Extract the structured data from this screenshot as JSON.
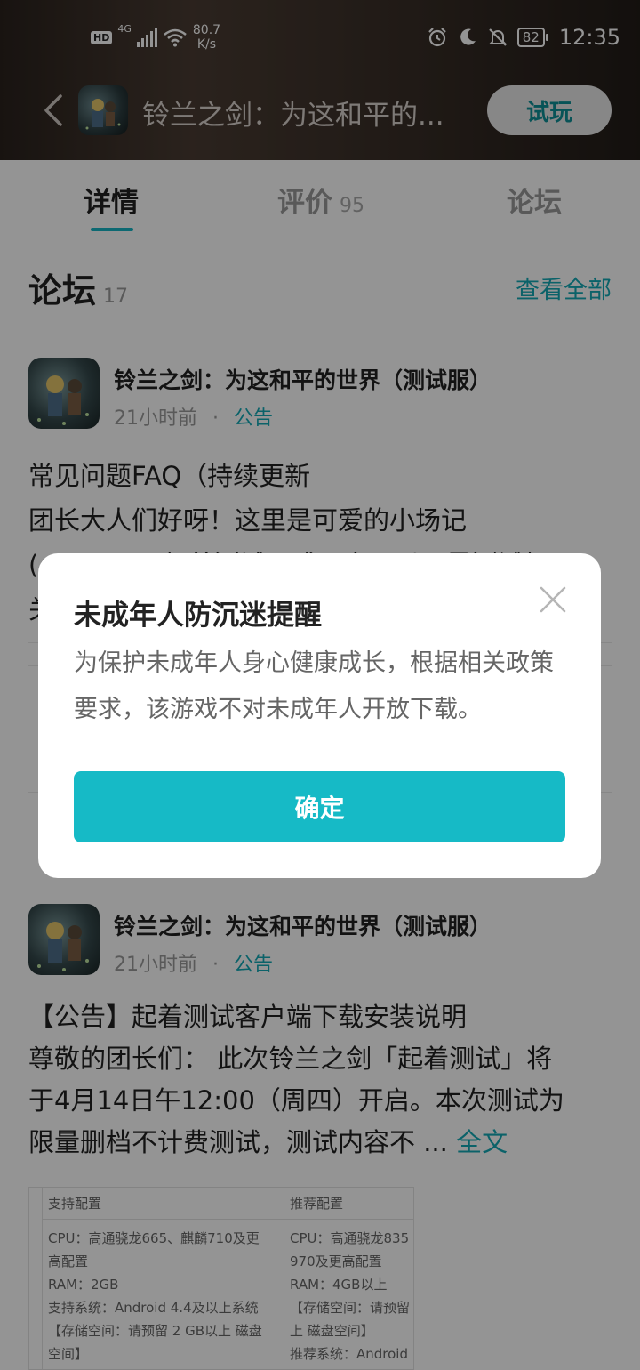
{
  "status_bar": {
    "hd_label": "HD",
    "network_type": "4G",
    "speed_value": "80.7",
    "speed_unit": "K/s",
    "battery": "82",
    "time": "12:35"
  },
  "header": {
    "title": "铃兰之剑：为这和平的...",
    "try_button": "试玩"
  },
  "tabs": [
    {
      "label": "详情",
      "count": ""
    },
    {
      "label": "评价",
      "count": "95"
    },
    {
      "label": "论坛",
      "count": ""
    }
  ],
  "forum": {
    "title": "论坛",
    "count": "17",
    "view_all": "查看全部"
  },
  "posts": [
    {
      "game": "铃兰之剑：为这和平的世界（测试服）",
      "time": "21小时前",
      "separator": "·",
      "tag": "公告",
      "lines": [
        "常见问题FAQ（持续更新",
        "团长大人们好呀！这里是可爱的小场记",
        "(●|ー|●)，起着测试正式开启，以下是测试相",
        "关"
      ]
    },
    {
      "game": "铃兰之剑：为这和平的世界（测试服）",
      "time": "21小时前",
      "separator": "·",
      "tag": "公告",
      "lines": [
        "【公告】起着测试客户端下载安装说明",
        "尊敬的团长们：  此次铃兰之剑「起着测试」将",
        "于4月14日午12:00（周四）开启。本次测试为",
        "限量删档不计费测试，测试内容不 ..."
      ],
      "more": "全文"
    }
  ],
  "config_table": {
    "col1_header": "支持配置",
    "col2_header": "推荐配置",
    "col1_text": "CPU：高通骁龙665、麒麟710及更\n高配置\nRAM：2GB\n支持系统：Android 4.4及以上系统\n【存储空间：请预留 2 GB以上 磁盘\n空间】",
    "col2_text": "CPU：高通骁龙835\n970及更高配置\nRAM：4GB以上\n【存储空间：请预留\n上 磁盘空间】\n推荐系统：Android"
  },
  "dialog": {
    "title": "未成年人防沉迷提醒",
    "message": "为保护未成年人身心健康成长，根据相关政策要求，该游戏不对未成年人开放下载。",
    "confirm": "确定"
  }
}
